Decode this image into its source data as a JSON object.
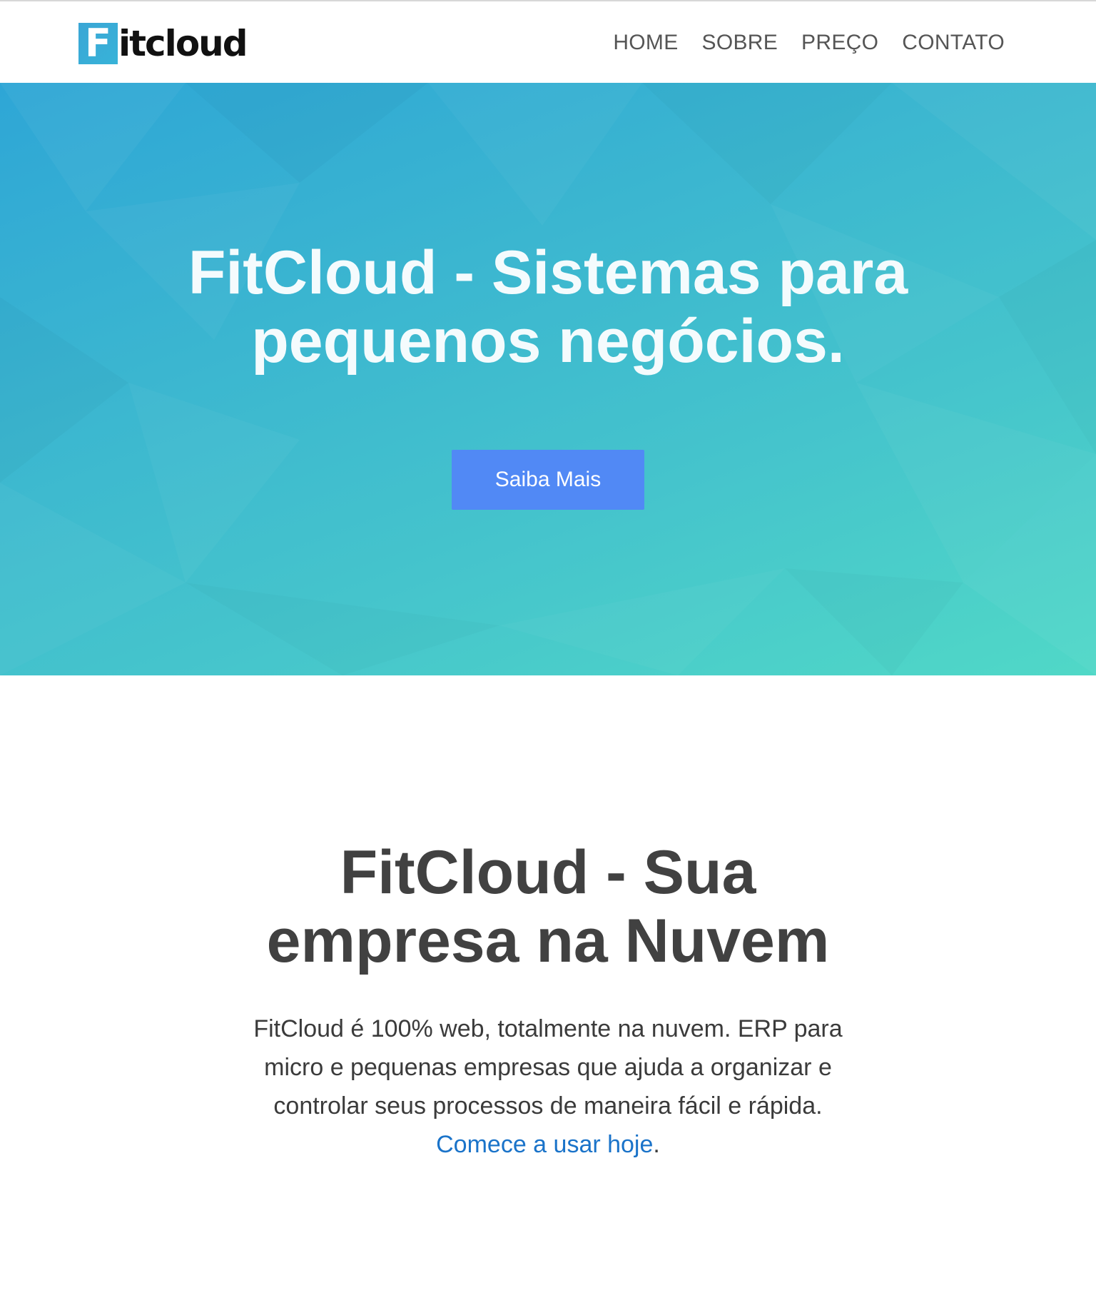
{
  "header": {
    "logo_letter": "F",
    "logo_rest": "itcloud",
    "nav": [
      "HOME",
      "SOBRE",
      "PREÇO",
      "CONTATO"
    ]
  },
  "hero": {
    "title_line1": "FitCloud - Sistemas para",
    "title_line2": "pequenos negócios.",
    "button_label": "Saiba Mais"
  },
  "about": {
    "title_line1": "FitCloud - Sua",
    "title_line2": "empresa na Nuvem",
    "text_line1": "FitCloud é 100% web, totalmente na nuvem. ERP para",
    "text_line2": "micro e pequenas empresas que ajuda a organizar e",
    "text_line3": "controlar seus processos de maneira fácil e rápida.",
    "link_text": "Comece a usar hoje",
    "link_suffix": "."
  },
  "colors": {
    "brand": "#38b3d8",
    "button": "#5189f5",
    "link": "#1a73c9",
    "hero_gradient_start": "#2ea6d6",
    "hero_gradient_end": "#50d8c7"
  }
}
